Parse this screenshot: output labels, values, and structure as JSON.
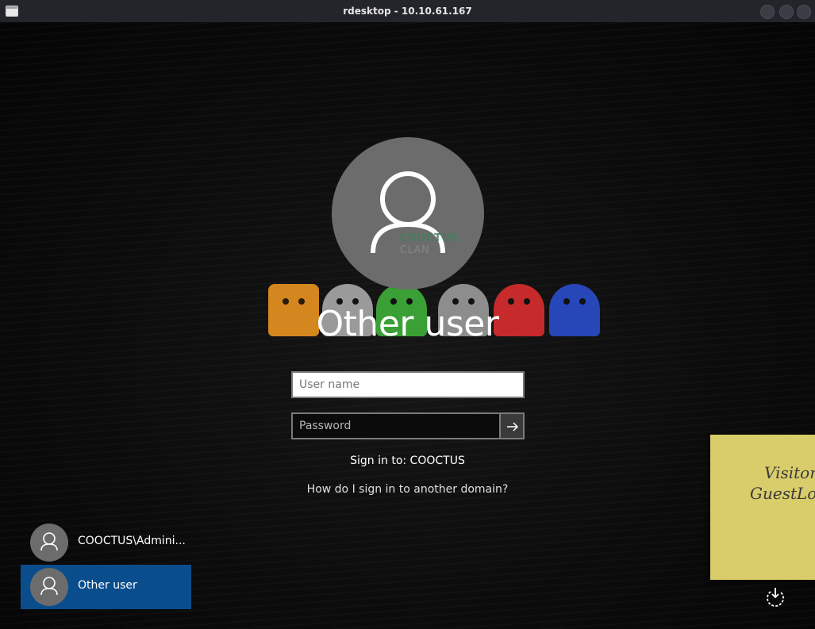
{
  "window": {
    "title": "rdesktop - 10.10.61.167"
  },
  "background": {
    "brand_text": "COOCTUS",
    "brand_suffix": "CLAN",
    "mascots": [
      {
        "name": "cat",
        "color": "#d4861f"
      },
      {
        "name": "skull",
        "color": "#9a9a9a"
      },
      {
        "name": "frog",
        "color": "#3aa035"
      },
      {
        "name": "snowman",
        "color": "#8d8d8d"
      },
      {
        "name": "red-ghost",
        "color": "#c62a2a"
      },
      {
        "name": "blue-ghost",
        "color": "#2746b8"
      }
    ]
  },
  "login": {
    "user_title": "Other user",
    "username_placeholder": "User name",
    "password_placeholder": "Password",
    "sign_in_to": "Sign in to: COOCTUS",
    "other_domain_link": "How do I sign in to another domain?"
  },
  "user_list": [
    {
      "label": "COOCTUS\\Admini...",
      "selected": false
    },
    {
      "label": "Other user",
      "selected": true
    }
  ],
  "sticky_note": {
    "line1": "Visitor",
    "line2": "GuestLo"
  },
  "colors": {
    "selected_user_bg": "#0a4d8c",
    "avatar_gray": "#6c6c6c",
    "sticky_yellow": "#d9cc6a"
  },
  "icons": {
    "avatar": "person-icon",
    "submit": "arrow-right-icon",
    "power": "power-icon"
  }
}
